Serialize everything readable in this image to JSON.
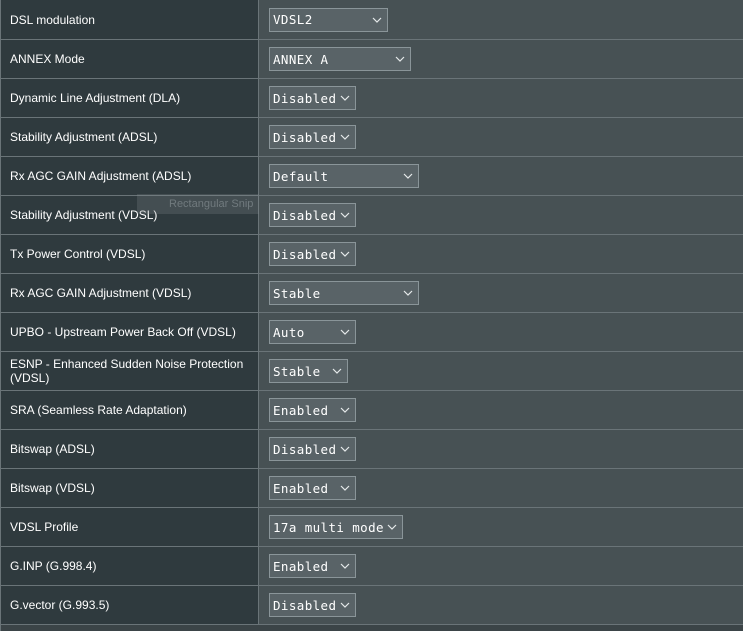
{
  "rows": [
    {
      "label": "DSL modulation",
      "value": "VDSL2"
    },
    {
      "label": "ANNEX Mode",
      "value": "ANNEX A"
    },
    {
      "label": "Dynamic Line Adjustment (DLA)",
      "value": "Disabled"
    },
    {
      "label": "Stability Adjustment (ADSL)",
      "value": "Disabled"
    },
    {
      "label": "Rx AGC GAIN Adjustment (ADSL)",
      "value": "Default"
    },
    {
      "label": "Stability Adjustment (VDSL)",
      "value": "Disabled"
    },
    {
      "label": "Tx Power Control (VDSL)",
      "value": "Disabled"
    },
    {
      "label": "Rx AGC GAIN Adjustment (VDSL)",
      "value": "Stable"
    },
    {
      "label": "UPBO - Upstream Power Back Off (VDSL)",
      "value": "Auto"
    },
    {
      "label": "ESNP - Enhanced Sudden Noise Protection (VDSL)",
      "value": "Stable"
    },
    {
      "label": "SRA (Seamless Rate Adaptation)",
      "value": "Enabled"
    },
    {
      "label": "Bitswap (ADSL)",
      "value": "Disabled"
    },
    {
      "label": "Bitswap (VDSL)",
      "value": "Enabled"
    },
    {
      "label": "VDSL Profile",
      "value": "17a multi mode"
    },
    {
      "label": "G.INP (G.998.4)",
      "value": "Enabled"
    },
    {
      "label": "G.vector (G.993.5)",
      "value": "Disabled"
    }
  ],
  "overlay": {
    "snip_text": "Rectangular Snip"
  },
  "icons": {
    "dropdown": "chevron-down-icon"
  },
  "colors": {
    "label_bg": "#2f3a3e",
    "value_bg": "#475154",
    "select_bg": "#596367",
    "border": "#6a7478"
  }
}
